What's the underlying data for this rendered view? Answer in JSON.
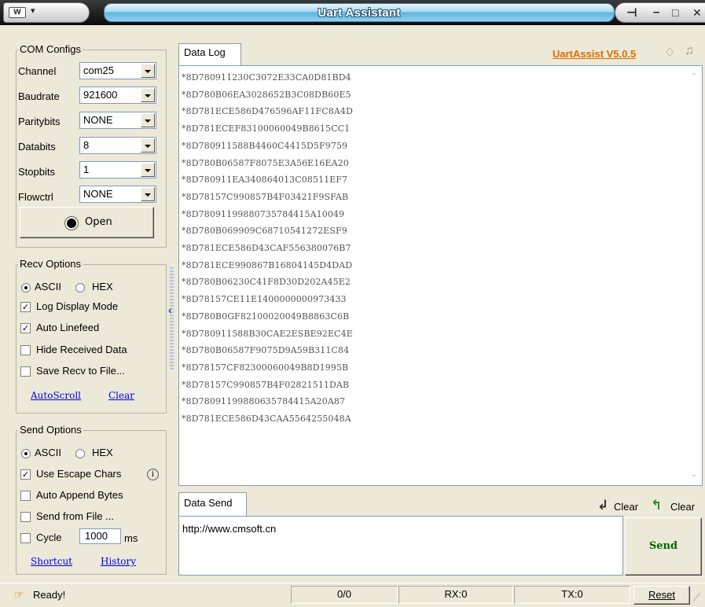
{
  "window": {
    "title": "Uart Assistant",
    "sys_icon": "W"
  },
  "com_configs": {
    "title": "COM Configs",
    "channel_label": "Channel",
    "channel": "com25",
    "baudrate_label": "Baudrate",
    "baudrate": "921600",
    "parity_label": "Paritybits",
    "parity": "NONE",
    "databits_label": "Databits",
    "databits": "8",
    "stopbits_label": "Stopbits",
    "stopbits": "1",
    "flowctrl_label": "Flowctrl",
    "flowctrl": "NONE",
    "open_label": "Open"
  },
  "recv_options": {
    "title": "Recv Options",
    "ascii_label": "ASCII",
    "hex_label": "HEX",
    "mode": "ASCII",
    "log_display_label": "Log Display Mode",
    "log_display": true,
    "auto_linefeed_label": "Auto Linefeed",
    "auto_linefeed": true,
    "hide_received_label": "Hide Received Data",
    "hide_received": false,
    "save_recv_label": "Save Recv to File...",
    "save_recv": false,
    "autoscroll_link": "AutoScroll",
    "clear_link": "Clear"
  },
  "send_options": {
    "title": "Send Options",
    "ascii_label": "ASCII",
    "hex_label": "HEX",
    "mode": "ASCII",
    "escape_label": "Use Escape Chars",
    "escape": true,
    "auto_append_label": "Auto Append Bytes",
    "auto_append": false,
    "send_file_label": "Send from File ...",
    "send_file": false,
    "cycle_label": "Cycle",
    "cycle_value": "1000",
    "cycle_unit": "ms",
    "cycle": false,
    "shortcut_link": "Shortcut",
    "history_link": "History"
  },
  "data_log": {
    "tab_label": "Data Log",
    "version_link": "UartAssist V5.0.5",
    "lines": [
      "*8D780911230C3072E33CA0D81BD4",
      "*8D780B06EA3028652B3C08DB60E5",
      "*8D781ECE586D476596AF11FC8A4D",
      "*8D781ECEF83100060049B8615CC1",
      "*8D780911588B4460C4415D5F9759",
      "*8D780B06587F8075E3A56E16EA20",
      "*8D780911EA340864013C08511EF7",
      "*8D78157C990857B4F03421F9SFAB",
      "*8D780911998807357844​15A10049",
      "*8D780B069909C68710541272ESF9",
      "*8D781ECE586D43CAF556380076B7",
      "*8D781ECE990867B16804145D4DAD",
      "*8D780B06230C41F8D30D202A45E2",
      "*8D78157CE11E1400000000973433",
      "*8D780B0GF82100020049B8863C6B",
      "*8D780911588B30CAE2ESBE92EC4E",
      "*8D780B06587F9075D9A59B311C84",
      "*8D78157CF82300060049B8D1995B",
      "*8D78157C990857B4F02821511DAB",
      "*8D780911998806357844​15A20A87",
      "*8D781ECE586D43CAA5564255048A"
    ]
  },
  "data_send": {
    "tab_label": "Data Send",
    "clear1_label": "Clear",
    "clear2_label": "Clear",
    "text": "http://www.cmsoft.cn",
    "send_label": "Send"
  },
  "status_bar": {
    "status": "Ready!",
    "counter": "0/0",
    "rx": "RX:0",
    "tx": "TX:0",
    "reset_label": "Reset"
  },
  "colors": {
    "version_link": "#e06c00",
    "send_button_text": "#006400",
    "link": "#0000ee"
  },
  "icons": [
    "system-menu-icon",
    "pin-icon",
    "minimize-icon",
    "maximize-icon",
    "close-icon",
    "diamond-icon",
    "bell-icon",
    "clear-arrow-down-icon",
    "clear-arrow-up-icon",
    "collapse-arrow-icon",
    "info-icon",
    "status-hand-icon",
    "resize-grip-icon"
  ]
}
